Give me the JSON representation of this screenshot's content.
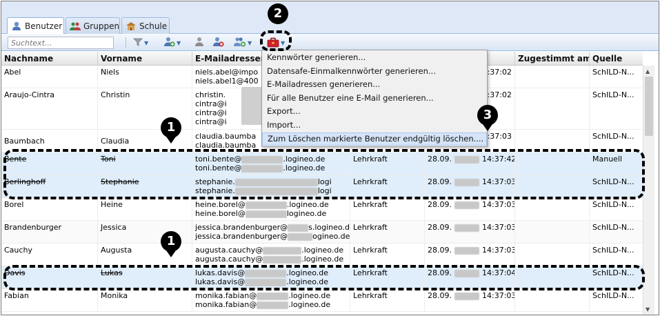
{
  "tabs": [
    {
      "label": "Benutzer",
      "icon": "user-icon",
      "active": true
    },
    {
      "label": "Gruppen",
      "icon": "group-icon",
      "active": false
    },
    {
      "label": "Schule",
      "icon": "school-icon",
      "active": false
    }
  ],
  "toolbar": {
    "search_placeholder": "Suchtext...",
    "buttons": [
      "filter-icon",
      "add-user-icon",
      "user-action-icon",
      "delete-user-icon",
      "group-add-icon",
      "toolbox-icon"
    ]
  },
  "columns": [
    "Nachname",
    "Vorname",
    "E-Mailadressen",
    "",
    "",
    "Zugestimmt am",
    "Quelle"
  ],
  "rows": [
    {
      "nachname": "Abel",
      "vorname": "Niels",
      "email1": "niels.abel@impo",
      "email2": "niels.abel1@400",
      "rolle": "",
      "datum": "",
      "zeit": "14:37:02",
      "quelle": "SchILD-N...",
      "strike": false
    },
    {
      "nachname": "Araujo-Cintra",
      "vorname": "Christin",
      "email1": "christin.",
      "email2": "cintra@i",
      "email3": "cintra@i",
      "email4": "cintra@i",
      "rolle": "",
      "datum": "",
      "zeit": "14:37:02",
      "quelle": "SchILD-N...",
      "strike": false
    },
    {
      "nachname": "Baumbach",
      "vorname": "Claudia",
      "email1": "claudia.baumba",
      "email2": "claudia.baumba",
      "rolle": "",
      "datum": "",
      "zeit": "14:37:03",
      "quelle": "SchILD-N...",
      "strike": false
    },
    {
      "nachname": "Bente",
      "vorname": "Toni",
      "email1": "toni.bente@",
      "email1b": ".logineo.de",
      "email2": "toni.bente@",
      "email2b": ".logineo.de",
      "rolle": "Lehrkraft",
      "datum": "28.09.",
      "zeit": "14:37:42",
      "quelle": "Manuell",
      "strike": true
    },
    {
      "nachname": "Berlinghoff",
      "vorname": "Stephanie",
      "email1": "stephanie.",
      "email1b": "logi",
      "email2": "stephanie.",
      "email2b": "logi",
      "rolle": "Lehrkraft",
      "datum": "28.09.",
      "zeit": "14:37:03",
      "quelle": "SchILD-N...",
      "strike": true
    },
    {
      "nachname": "Borel",
      "vorname": "Heine",
      "email1": "heine.borel@",
      "email1b": ".logineo.de",
      "email2": "heine.borel@",
      "email2b": "logineo.de",
      "rolle": "Lehrkraft",
      "datum": "28.09.",
      "zeit": "14:37:03",
      "quelle": "SchILD-N...",
      "strike": false
    },
    {
      "nachname": "Brandenburger",
      "vorname": "Jessica",
      "email1": "jessica.brandenburger@",
      "email1b": "s.logineo.de",
      "email2": "jessica.brandenburger@",
      "email2b": "ogineo.de",
      "rolle": "Lehrkraft",
      "datum": "28.09.",
      "zeit": "14:37:03",
      "quelle": "SchILD-N...",
      "strike": false
    },
    {
      "nachname": "Cauchy",
      "vorname": "Augusta",
      "email1": "augusta.cauchy@",
      "email1b": ".logineo.de",
      "email2": "augusta.cauchy@",
      "email2b": ".logineo.de",
      "rolle": "Lehrkraft",
      "datum": "28.09.",
      "zeit": "14:37:03",
      "quelle": "SchILD-N...",
      "strike": false
    },
    {
      "nachname": "Davis",
      "vorname": "Lukas",
      "email1": "lukas.davis@",
      "email1b": ".logineo.de",
      "email2": "lukas.davis@",
      "email2b": ".logineo.de",
      "rolle": "Lehrkraft",
      "datum": "28.09.",
      "zeit": "14:37:04",
      "quelle": "SchILD-N...",
      "strike": true
    },
    {
      "nachname": "Fabian",
      "vorname": "Monika",
      "email1": "monika.fabian@",
      "email1b": ".logineo.de",
      "email2": "monika.fabian@",
      "email2b": ".logineo.de",
      "rolle": "Lehrkraft",
      "datum": "28.09.",
      "zeit": "14:37:03",
      "quelle": "SchILD-N...",
      "strike": false
    }
  ],
  "menu": {
    "items": [
      "Kennwörter generieren...",
      "Datensafe-Einmalkennwörter generieren...",
      "E-Mailadressen generieren...",
      "Für alle Benutzer eine E-Mail generieren...",
      "Export...",
      "Import...",
      "Zum Löschen markierte Benutzer endgültig löschen...."
    ],
    "highlighted_index": 6
  },
  "callouts": [
    "1",
    "2",
    "3",
    "1"
  ],
  "colors": {
    "accent": "#99bbe8",
    "selected_row": "#e0eefb",
    "menu_highlight": "#d5e4f7",
    "toolbox_red": "#d0202a"
  }
}
